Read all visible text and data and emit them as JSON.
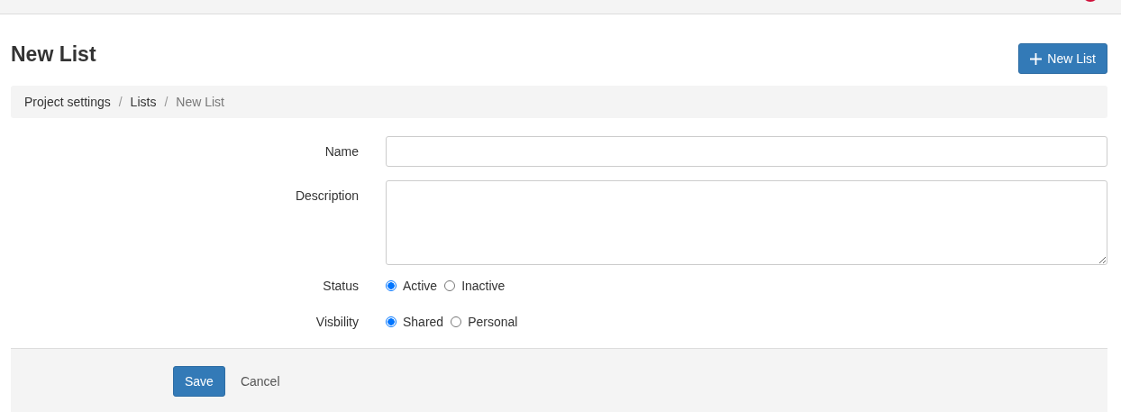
{
  "title": "New List",
  "new_button": {
    "label": "New List"
  },
  "breadcrumb": {
    "separator": "/",
    "items": [
      {
        "label": "Project settings",
        "link": true
      },
      {
        "label": "Lists",
        "link": true
      },
      {
        "label": "New List",
        "link": false
      }
    ]
  },
  "fields": [
    {
      "kind": "text",
      "label": "Name"
    },
    {
      "kind": "textarea",
      "label": "Description"
    },
    {
      "kind": "radio",
      "label": "Status",
      "options": [
        {
          "label": "Active",
          "selected": true
        },
        {
          "label": "Inactive",
          "selected": false
        }
      ]
    },
    {
      "kind": "radio",
      "label": "Visbility",
      "options": [
        {
          "label": "Shared",
          "selected": true
        },
        {
          "label": "Personal",
          "selected": false
        }
      ]
    }
  ],
  "actions": [
    {
      "kind": "primary",
      "label": "Save"
    },
    {
      "kind": "link",
      "label": "Cancel"
    }
  ]
}
